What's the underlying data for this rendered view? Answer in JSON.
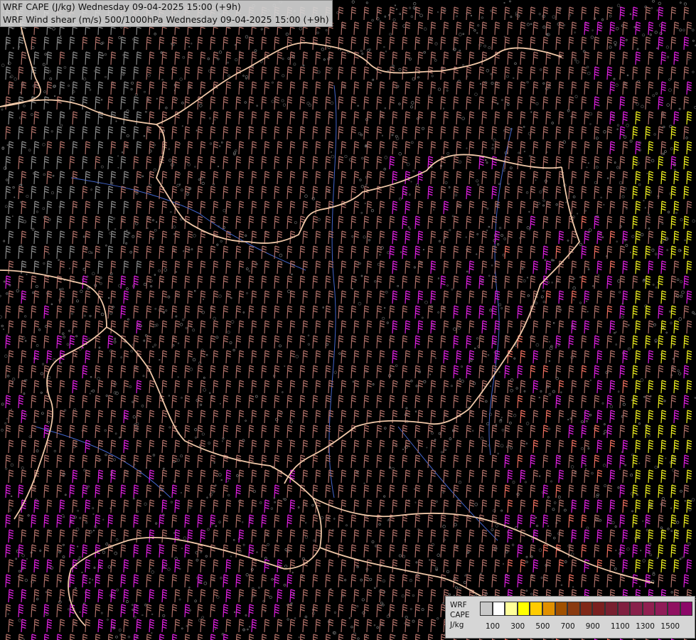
{
  "title": {
    "line1": "WRF CAPE (J/kg) Wednesday 09-04-2025 15:00 (+9h)",
    "line2": "WRF Wind shear (m/s) 500/1000hPa Wednesday 09-04-2025 15:00 (+9h)"
  },
  "legend": {
    "label_line1": "WRF",
    "label_line2": "CAPE",
    "label_line3": "J/kg",
    "colors": [
      "#c8c8c8",
      "#ffffff",
      "#ffff99",
      "#ffff00",
      "#ffcc00",
      "#e09000",
      "#a05000",
      "#8a3a10",
      "#802818",
      "#7a2020",
      "#782030",
      "#802040",
      "#88204a",
      "#902050",
      "#901c58",
      "#901060",
      "#8c0868"
    ],
    "ticks": [
      "100",
      "300",
      "500",
      "700",
      "900",
      "1100",
      "1300",
      "1500"
    ]
  },
  "colors": {
    "background": "#000000",
    "border": "#f0c8a8",
    "river": "#4466cc",
    "barb_default": "#b07068",
    "barb_grey": "#8a8a8a",
    "barb_magenta": "#e020e0",
    "barb_yellow": "#f0f020",
    "barb_salmon": "#f07060"
  }
}
